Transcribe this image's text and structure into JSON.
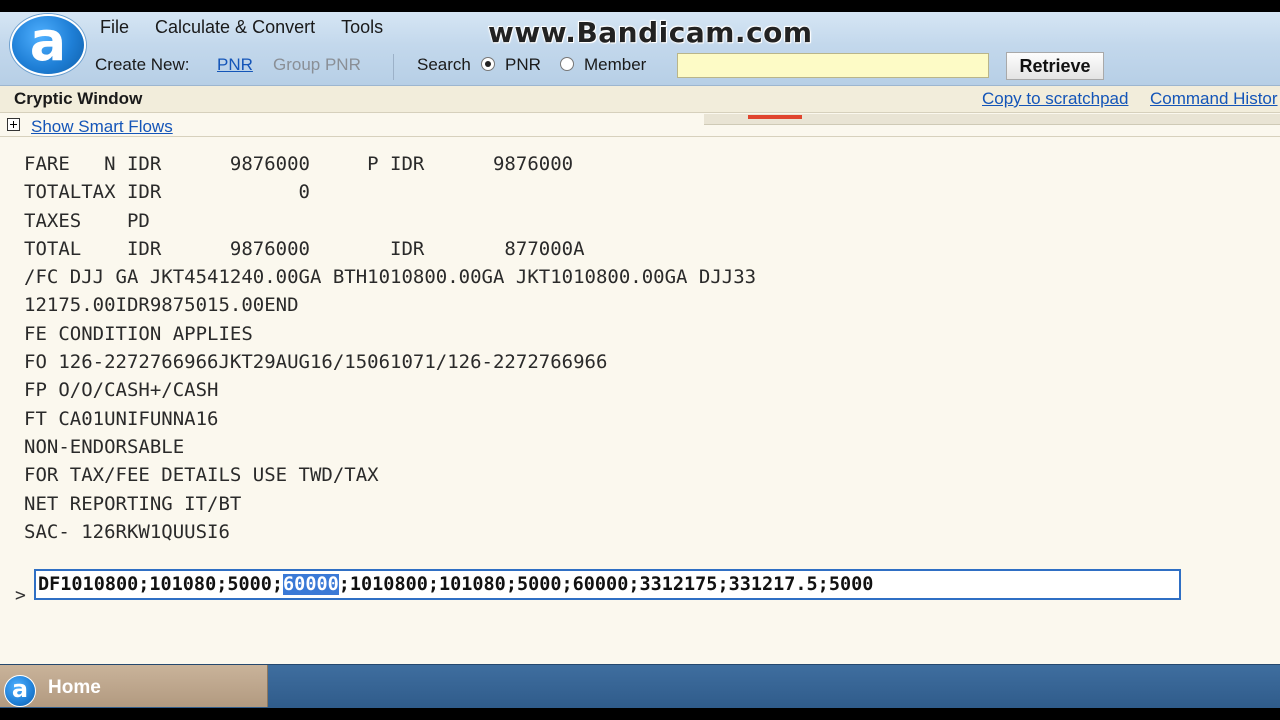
{
  "watermark": "www.Bandicam.com",
  "logo_letter": "a",
  "menu": [
    {
      "label": "File"
    },
    {
      "label": "Calculate & Convert"
    },
    {
      "label": "Tools"
    }
  ],
  "create_new": {
    "label": "Create New:",
    "pnr": "PNR",
    "group_pnr": "Group PNR"
  },
  "search": {
    "label": "Search",
    "option_pnr": "PNR",
    "option_member": "Member",
    "selected": "PNR",
    "value": "",
    "button": "Retrieve"
  },
  "cryptic": {
    "title": "Cryptic Window",
    "copy_scratchpad": "Copy to scratchpad",
    "command_history": "Command Histor",
    "show_smart_flows": "Show Smart Flows"
  },
  "terminal": {
    "lines": [
      "FARE   N IDR      9876000     P IDR      9876000",
      "TOTALTAX IDR            0",
      "TAXES    PD",
      "TOTAL    IDR      9876000       IDR       877000A",
      "/FC DJJ GA JKT4541240.00GA BTH1010800.00GA JKT1010800.00GA DJJ33",
      "12175.00IDR9875015.00END",
      "FE CONDITION APPLIES",
      "FO 126-2272766966JKT29AUG16/15061071/126-2272766966",
      "FP O/O/CASH+/CASH",
      "FT CA01UNIFUNNA16",
      "NON-ENDORSABLE",
      "FOR TAX/FEE DETAILS USE TWD/TAX",
      "NET REPORTING IT/BT",
      "SAC- 126RKW1QUUSI6"
    ],
    "prompt": ">",
    "command_before": "DF1010800;101080;5000;",
    "command_selected": "60000",
    "command_after": ";1010800;101080;5000;60000;3312175;331217.5;5000"
  },
  "bottom": {
    "home_label": "Home"
  },
  "colors": {
    "link": "#1455b8",
    "selection": "#3a79d6",
    "input_bg": "#fdfbc6"
  }
}
